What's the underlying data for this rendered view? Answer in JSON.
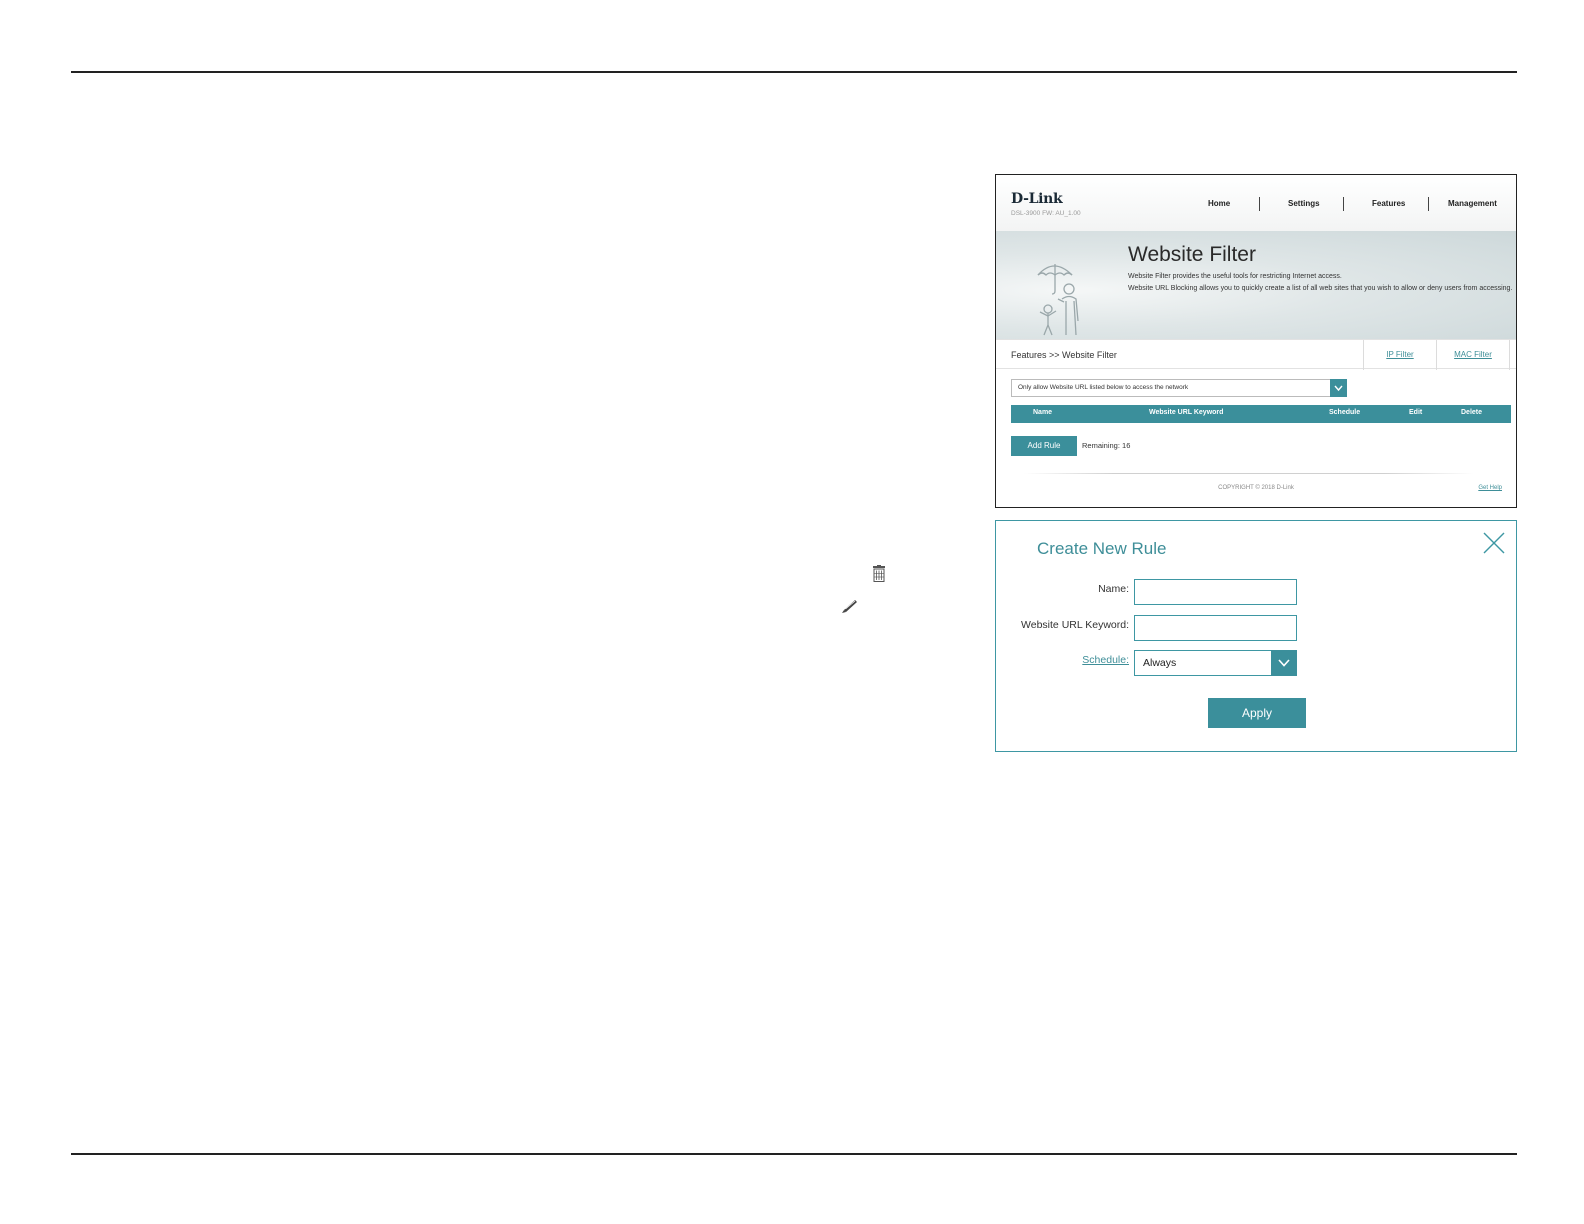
{
  "panel1": {
    "header": {
      "logo": "D-Link",
      "model": "DSL-3900   FW: AU_1.00",
      "nav": [
        "Home",
        "Settings",
        "Features",
        "Management"
      ]
    },
    "hero": {
      "title": "Website Filter",
      "desc_line1": "Website Filter provides the useful tools for restricting Internet access.",
      "desc_line2": "Website URL Blocking allows you to quickly create a list of all web sites that you wish to allow or deny users from accessing."
    },
    "breadcrumb": "Features >> Website Filter",
    "tabs": [
      "IP Filter",
      "MAC Filter"
    ],
    "filter_mode": "Only allow Website URL listed below to access the network",
    "table_headers": [
      "Name",
      "Website URL Keyword",
      "Schedule",
      "Edit",
      "Delete"
    ],
    "add_rule_label": "Add Rule",
    "remaining": "Remaining: 16",
    "copyright": "COPYRIGHT © 2018 D-Link",
    "get_help": "Get Help"
  },
  "panel2": {
    "title": "Create New Rule",
    "name_label": "Name:",
    "name_value": "",
    "keyword_label": "Website URL Keyword:",
    "keyword_value": "",
    "schedule_label": "Schedule:",
    "schedule_value": "Always",
    "apply_label": "Apply"
  },
  "icons": {
    "side": [
      "trash-icon",
      "pencil-icon"
    ],
    "modal": [
      "close-icon",
      "chevron-down-icon"
    ]
  },
  "colors": {
    "accent": "#3b8f9b",
    "link": "#3e8e98",
    "rule": "#222222"
  }
}
